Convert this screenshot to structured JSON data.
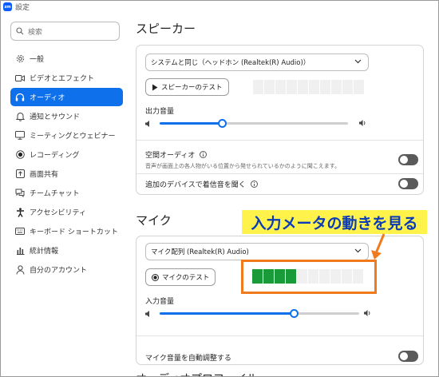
{
  "window": {
    "title": "設定",
    "logo_text": "zm"
  },
  "sidebar": {
    "search_placeholder": "検索",
    "items": [
      {
        "label": "一般",
        "icon": "gear-icon"
      },
      {
        "label": "ビデオとエフェクト",
        "icon": "video-icon"
      },
      {
        "label": "オーディオ",
        "icon": "headphones-icon",
        "active": true
      },
      {
        "label": "通知とサウンド",
        "icon": "bell-icon"
      },
      {
        "label": "ミーティングとウェビナー",
        "icon": "monitor-icon"
      },
      {
        "label": "レコーディング",
        "icon": "record-icon"
      },
      {
        "label": "画面共有",
        "icon": "share-screen-icon"
      },
      {
        "label": "チームチャット",
        "icon": "chat-icon"
      },
      {
        "label": "アクセシビリティ",
        "icon": "accessibility-icon"
      },
      {
        "label": "キーボード ショートカット",
        "icon": "keyboard-icon"
      },
      {
        "label": "統計情報",
        "icon": "stats-icon"
      },
      {
        "label": "自分のアカウント",
        "icon": "person-icon"
      }
    ]
  },
  "speaker": {
    "title": "スピーカー",
    "device": "システムと同じ（ヘッドホン (Realtek(R) Audio)）",
    "test_button": "スピーカーのテスト",
    "output_volume_label": "出力音量",
    "output_volume": 0.33,
    "meter_segments": 10,
    "meter_active": 0,
    "spatial_audio_label": "空間オーディオ",
    "spatial_audio_desc": "音声が画面上の各人物がいる位置から発せられているかのように聞こえます。",
    "spatial_audio_on": false,
    "additional_device_label": "追加のデバイスで着信音を聞く",
    "additional_device_on": false
  },
  "mic": {
    "title": "マイク",
    "device": "マイク配列 (Realtek(R) Audio)",
    "test_button": "マイクのテスト",
    "input_volume_label": "入力音量",
    "input_volume": 0.67,
    "meter_segments": 10,
    "meter_active": 4,
    "auto_adjust_label": "マイク音量を自動調整する",
    "auto_adjust_on": false
  },
  "next_section_title": "オーディオプロファイル",
  "annotation": {
    "text": "入力メータの動きを見る"
  },
  "colors": {
    "accent": "#0e71eb",
    "meter_on": "#1a9b3a",
    "annotation_bg": "#fff24a",
    "annotation_text": "#0b3bb8",
    "highlight_border": "#f07b1f"
  }
}
